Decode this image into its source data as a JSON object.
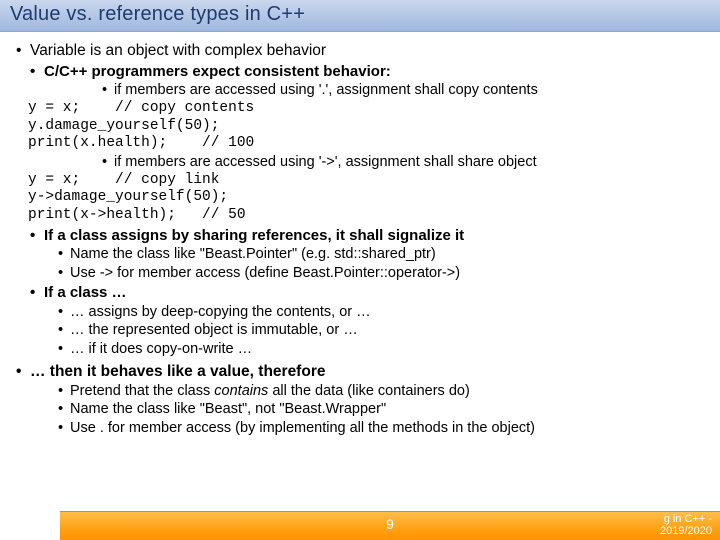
{
  "title": "Value vs. reference types in C++",
  "l1a": "Variable is an object with complex behavior",
  "l2a": "C/C++ programmers expect consistent behavior:",
  "l3a": "if members are accessed using '.', assignment shall copy contents",
  "code1": "y = x;    // copy contents\ny.damage_yourself(50);\nprint(x.health);    // 100",
  "l3b": "if members are accessed using '->', assignment shall share object",
  "code2": "y = x;    // copy link\ny->damage_yourself(50);\nprint(x->health);   // 50",
  "l2b": "If a class assigns by sharing references, it shall signalize it",
  "l3c": "Name the class like \"Beast.Pointer\" (e.g. std::shared_ptr)",
  "l3d": "Use -> for member access (define Beast.Pointer::operator->)",
  "l2c": "If a class …",
  "l3e": "… assigns by deep-copying the contents, or …",
  "l3f": "… the represented object is immutable, or …",
  "l3g": "… if it does copy-on-write …",
  "l1b": "… then it behaves like a value, therefore",
  "l3h_pre": "Pretend that the class ",
  "l3h_em": "contains",
  "l3h_post": " all the data (like containers do)",
  "l3i": "Name the class like \"Beast\", not \"Beast.Wrapper\"",
  "l3j": "Use . for member access (by implementing all the methods in the object)",
  "page": "9",
  "foot1": "g in C++ -",
  "foot2": "2019/2020"
}
